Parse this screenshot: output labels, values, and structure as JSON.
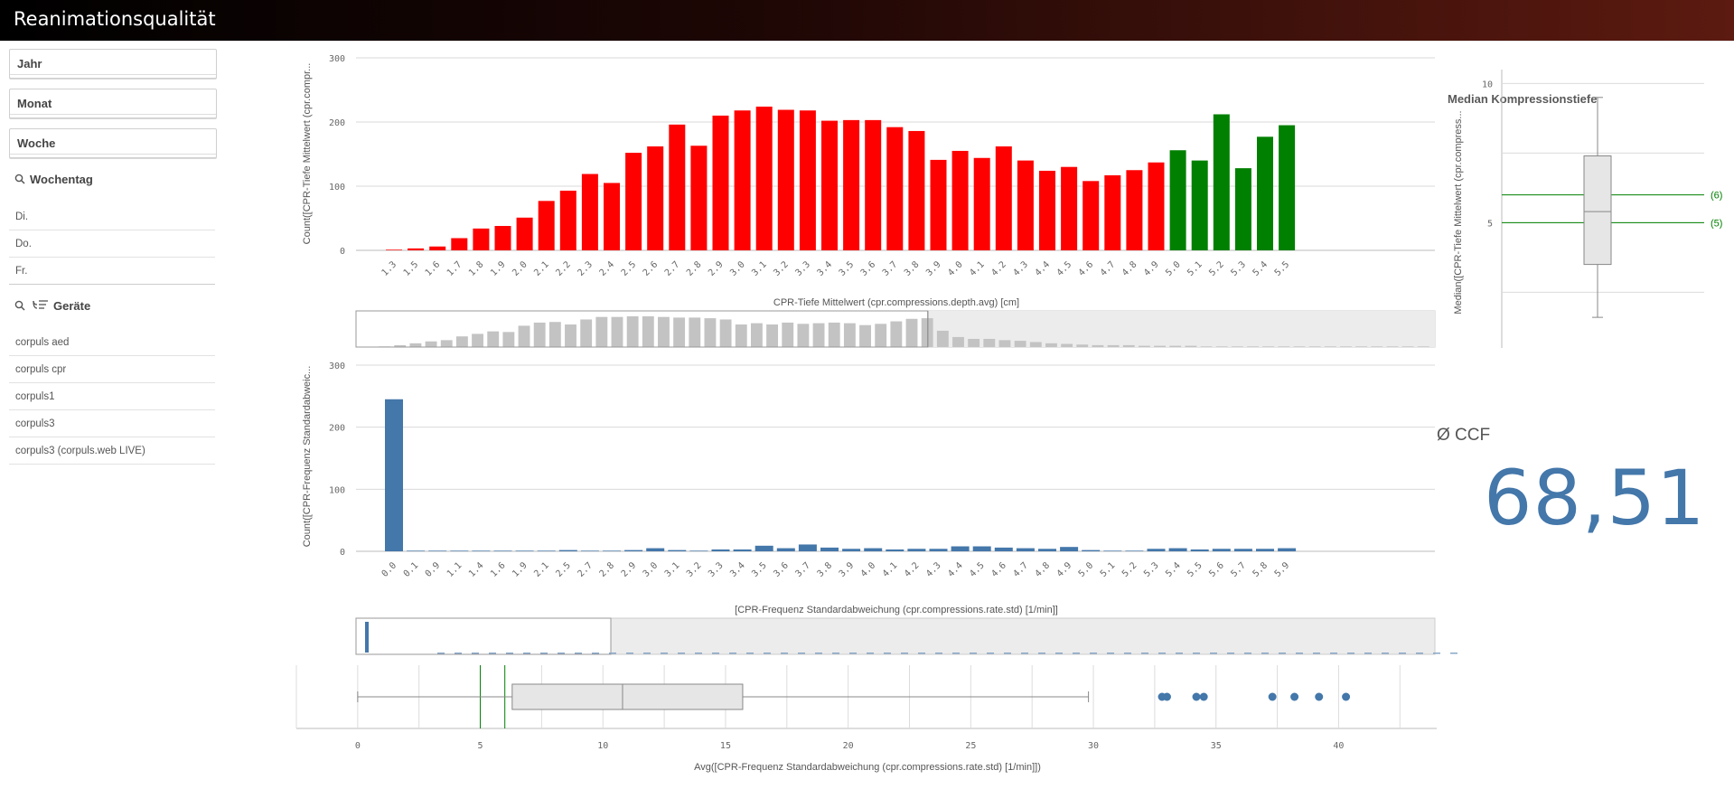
{
  "app": {
    "title": "Reanimationsqualität"
  },
  "filters": [
    {
      "label": "Jahr"
    },
    {
      "label": "Monat"
    },
    {
      "label": "Woche"
    }
  ],
  "wochentag": {
    "title": "Wochentag",
    "items": [
      "Di.",
      "Do.",
      "Fr."
    ]
  },
  "geraete": {
    "title": "Geräte",
    "items": [
      "corpuls aed",
      "corpuls cpr",
      "corpuls1",
      "corpuls3",
      "corpuls3 (corpuls.web LIVE)"
    ]
  },
  "colors": {
    "red": "#ff0000",
    "green": "#008000",
    "blue": "#4477aa",
    "grey": "#c3c3c3"
  },
  "chart_data": [
    {
      "type": "bar",
      "xlabel": "CPR-Tiefe Mittelwert (cpr.compressions.depth.avg) [cm]",
      "ylabel": "Count([CPR-Tiefe Mittelwert (cpr.compr...",
      "ylim": [
        0,
        300
      ],
      "yticks": [
        0,
        100,
        200,
        300
      ],
      "categories": [
        "1.3",
        "1.5",
        "1.6",
        "1.7",
        "1.8",
        "1.9",
        "2.0",
        "2.1",
        "2.2",
        "2.3",
        "2.4",
        "2.5",
        "2.6",
        "2.7",
        "2.8",
        "2.9",
        "3.0",
        "3.1",
        "3.2",
        "3.3",
        "3.4",
        "3.5",
        "3.6",
        "3.7",
        "3.8",
        "3.9",
        "4.0",
        "4.1",
        "4.2",
        "4.3",
        "4.4",
        "4.5",
        "4.6",
        "4.7",
        "4.8",
        "4.9",
        "5.0",
        "5.1",
        "5.2",
        "5.3",
        "5.4",
        "5.5"
      ],
      "values": [
        1,
        3,
        6,
        19,
        34,
        38,
        51,
        77,
        93,
        119,
        105,
        152,
        162,
        196,
        163,
        210,
        218,
        224,
        219,
        218,
        202,
        203,
        203,
        192,
        186,
        141,
        155,
        144,
        162,
        140,
        124,
        130,
        108,
        117,
        125,
        137,
        156,
        140,
        212,
        128,
        177,
        195
      ],
      "colors_by_category": "red below 5.0, green from 5.0",
      "grid": true
    },
    {
      "type": "bar",
      "role": "scrollbar-mini-chart",
      "values": [
        0,
        1,
        3,
        6,
        9,
        11,
        17,
        21,
        25,
        24,
        34,
        39,
        40,
        36,
        44,
        48,
        48,
        49,
        49,
        48,
        47,
        47,
        46,
        44,
        36,
        38,
        36,
        39,
        37,
        38,
        39,
        38,
        35,
        37,
        41,
        45,
        46,
        26,
        16,
        13,
        13,
        11,
        10,
        8,
        6,
        5,
        4,
        3,
        3,
        3,
        2,
        2,
        2,
        2,
        1,
        1,
        1,
        1,
        1,
        1,
        1,
        1,
        1,
        1,
        1,
        1,
        1,
        1,
        1
      ],
      "visible_fraction": 0.53
    },
    {
      "type": "bar",
      "xlabel": "[CPR-Frequenz Standardabweichung (cpr.compressions.rate.std) [1/min]]",
      "ylabel": "Count([CPR-Frequenz Standardabweic...",
      "ylim": [
        0,
        300
      ],
      "yticks": [
        0,
        100,
        200,
        300
      ],
      "categories": [
        "0.0",
        "0.1",
        "0.9",
        "1.1",
        "1.4",
        "1.6",
        "1.9",
        "2.1",
        "2.5",
        "2.7",
        "2.8",
        "2.9",
        "3.0",
        "3.1",
        "3.2",
        "3.3",
        "3.4",
        "3.5",
        "3.6",
        "3.7",
        "3.8",
        "3.9",
        "4.0",
        "4.1",
        "4.2",
        "4.3",
        "4.4",
        "4.5",
        "4.6",
        "4.7",
        "4.8",
        "4.9",
        "5.0",
        "5.1",
        "5.2",
        "5.3",
        "5.4",
        "5.5",
        "5.6",
        "5.7",
        "5.8",
        "5.9"
      ],
      "values": [
        245,
        1,
        1,
        1,
        1,
        1,
        1,
        1,
        2,
        1,
        1,
        2,
        5,
        2,
        1,
        3,
        3,
        9,
        5,
        11,
        6,
        4,
        5,
        3,
        4,
        4,
        8,
        8,
        6,
        5,
        4,
        7,
        2,
        1,
        1,
        4,
        5,
        3,
        4,
        4,
        4,
        5
      ],
      "grid": true
    },
    {
      "type": "box",
      "xlabel": "Avg([CPR-Frequenz Standardabweichung (cpr.compressions.rate.std) [1/min]])",
      "xlim": [
        -2.5,
        44
      ],
      "xticks": [
        0,
        5,
        10,
        15,
        20,
        25,
        30,
        35,
        40
      ],
      "whisker_low": 0,
      "q1": 6.3,
      "median": 10.8,
      "q3": 15.7,
      "whisker_high": 29.8,
      "outliers": [
        32.8,
        33.0,
        34.2,
        34.5,
        37.3,
        38.2,
        39.2,
        40.3
      ],
      "reference_lines": [
        5,
        6
      ]
    },
    {
      "type": "box",
      "title": "Median Kompressionstiefe",
      "ylabel": "Median([CPR-Tiefe Mittelwert (cpr.compress...",
      "yticks": [
        5,
        10
      ],
      "ylim": [
        0.5,
        10.5
      ],
      "whisker_low": 1.6,
      "q1": 3.5,
      "median": 5.4,
      "q3": 7.4,
      "whisker_high": 9.5,
      "reference_lines": [
        {
          "value": 6,
          "label": "(6)"
        },
        {
          "value": 5,
          "label": "(5)"
        }
      ]
    }
  ],
  "kpi": {
    "title": "Ø CCF",
    "value": "68,51"
  }
}
